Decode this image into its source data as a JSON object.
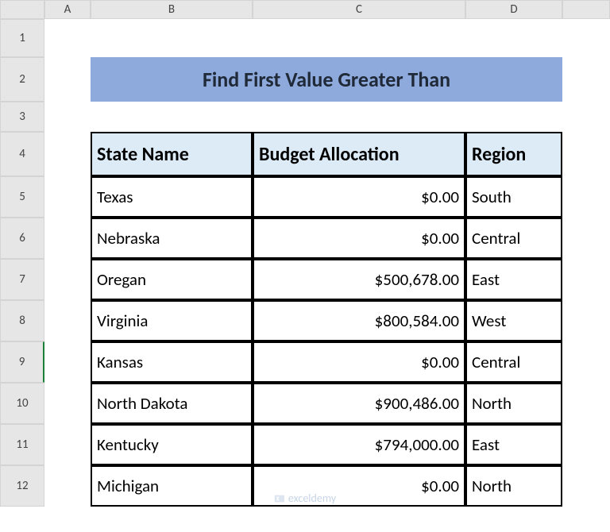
{
  "columns": [
    "A",
    "B",
    "C",
    "D"
  ],
  "rows": [
    "1",
    "2",
    "3",
    "4",
    "5",
    "6",
    "7",
    "8",
    "9",
    "10",
    "11",
    "12"
  ],
  "title": "Find First Value Greater Than",
  "headers": {
    "state": "State Name",
    "budget": "Budget Allocation",
    "region": "Region"
  },
  "data": [
    {
      "state": "Texas",
      "budget": "$0.00",
      "region": "South"
    },
    {
      "state": "Nebraska",
      "budget": "$0.00",
      "region": "Central"
    },
    {
      "state": "Oregan",
      "budget": "$500,678.00",
      "region": "East"
    },
    {
      "state": "Virginia",
      "budget": "$800,584.00",
      "region": "West"
    },
    {
      "state": "Kansas",
      "budget": "$0.00",
      "region": "Central"
    },
    {
      "state": "North Dakota",
      "budget": "$900,486.00",
      "region": "North"
    },
    {
      "state": "Kentucky",
      "budget": "$794,000.00",
      "region": "East"
    },
    {
      "state": "Michigan",
      "budget": "$0.00",
      "region": "North"
    }
  ],
  "watermark": "exceldemy"
}
